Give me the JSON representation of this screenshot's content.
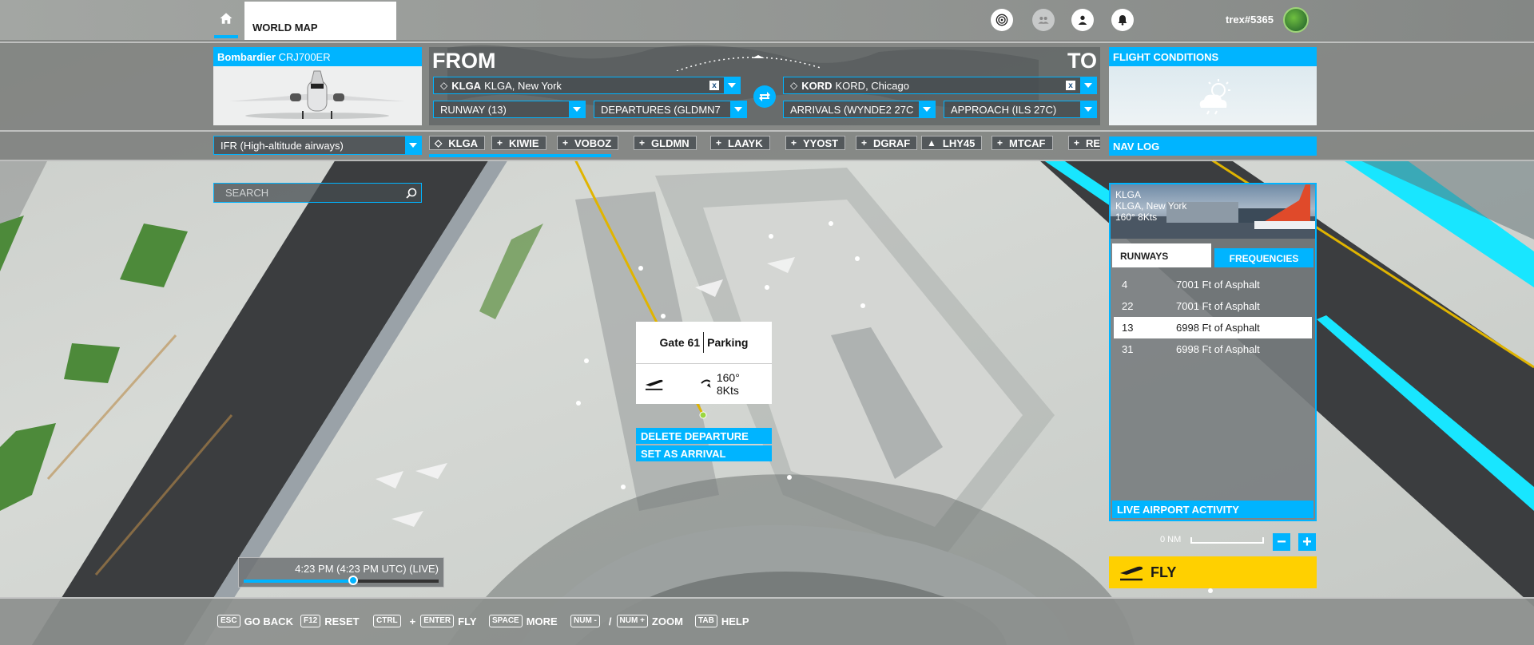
{
  "topbar": {
    "world_map_label": "WORLD MAP",
    "username": "trex#5365"
  },
  "aircraft": {
    "brand": "Bombardier",
    "model": "CRJ700ER"
  },
  "route": {
    "from_label": "FROM",
    "to_label": "TO",
    "departure": {
      "code": "KLGA",
      "name": "KLGA, New York"
    },
    "arrival": {
      "code": "KORD",
      "name": "KORD, Chicago"
    },
    "clear_symbol": "x",
    "runway": "RUNWAY (13)",
    "departure_procedure": "DEPARTURES (GLDMN7",
    "arrival_procedure": "ARRIVALS (WYNDE2 27C",
    "approach": "APPROACH (ILS 27C)",
    "flight_type": "IFR (High-altitude airways)"
  },
  "flight_conditions": {
    "title": "FLIGHT CONDITIONS",
    "icon": "partly-cloudy-icon"
  },
  "waypoints": [
    {
      "label": "KLGA",
      "symbol": "◇"
    },
    {
      "label": "KIWIE",
      "symbol": "+"
    },
    {
      "label": "VOBOZ",
      "symbol": "+"
    },
    {
      "label": "GLDMN",
      "symbol": "+"
    },
    {
      "label": "LAAYK",
      "symbol": "+"
    },
    {
      "label": "YYOST",
      "symbol": "+"
    },
    {
      "label": "DGRAF",
      "symbol": "+"
    },
    {
      "label": "LHY45",
      "symbol": "▲"
    },
    {
      "label": "MTCAF",
      "symbol": "+"
    },
    {
      "label": "RE",
      "symbol": "+"
    }
  ],
  "nav_log": {
    "title": "NAV LOG"
  },
  "search": {
    "placeholder": "SEARCH"
  },
  "gate_popup": {
    "gate": "Gate 61",
    "type": "Parking",
    "wind": "160° 8Kts",
    "delete_departure": "DELETE DEPARTURE",
    "set_as_arrival": "SET AS ARRIVAL"
  },
  "airport_panel": {
    "code": "KLGA",
    "name": "KLGA, New York",
    "wind": "160° 8Kts",
    "tabs": {
      "runways": "RUNWAYS",
      "frequencies": "FREQUENCIES"
    },
    "runways": [
      {
        "num": "4",
        "desc": "7001 Ft of Asphalt"
      },
      {
        "num": "22",
        "desc": "7001 Ft of Asphalt"
      },
      {
        "num": "13",
        "desc": "6998 Ft of Asphalt",
        "selected": true
      },
      {
        "num": "31",
        "desc": "6998 Ft of Asphalt"
      }
    ],
    "live_activity": "LIVE AIRPORT ACTIVITY"
  },
  "map": {
    "scale_label": "0 NM",
    "zoom_out": "−",
    "zoom_in": "+"
  },
  "fly": {
    "label": "FLY"
  },
  "time": {
    "text": "4:23 PM (4:23 PM UTC) (LIVE)",
    "progress": 0.56
  },
  "hints": [
    {
      "keys": [
        "ESC"
      ],
      "label": "GO BACK"
    },
    {
      "keys": [
        "F12"
      ],
      "label": "RESET"
    },
    {
      "keys": [
        "CTRL",
        "ENTER"
      ],
      "joiner": "+",
      "label": "FLY"
    },
    {
      "keys": [
        "SPACE"
      ],
      "label": "MORE"
    },
    {
      "keys": [
        "NUM -",
        "NUM +"
      ],
      "joiner": "/",
      "label": "ZOOM"
    },
    {
      "keys": [
        "TAB"
      ],
      "label": "HELP"
    }
  ],
  "colors": {
    "accent": "#00b4ff",
    "fly": "#ffd000",
    "route_line": "#e0b400",
    "airway_highlight": "#18e6ff"
  }
}
